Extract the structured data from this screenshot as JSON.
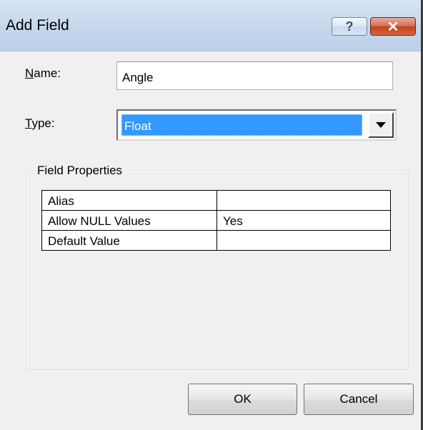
{
  "window": {
    "title": "Add Field",
    "help_glyph": "?",
    "close_glyph": "✕"
  },
  "form": {
    "name_label_key": "N",
    "name_label_rest": "ame:",
    "name_value": "Angle",
    "type_label_key": "T",
    "type_label_rest": "ype:",
    "type_value": "Float"
  },
  "field_properties": {
    "title": "Field Properties",
    "rows": [
      {
        "property": "Alias",
        "value": ""
      },
      {
        "property": "Allow NULL Values",
        "value": "Yes"
      },
      {
        "property": "Default Value",
        "value": ""
      }
    ]
  },
  "buttons": {
    "ok": "OK",
    "cancel": "Cancel"
  },
  "icons": {
    "help": "help-icon",
    "close": "close-icon",
    "dropdown": "chevron-down-icon"
  },
  "colors": {
    "selection": "#3399ff",
    "titlebar": "#c4d6ec",
    "close_button": "#c2411f"
  }
}
